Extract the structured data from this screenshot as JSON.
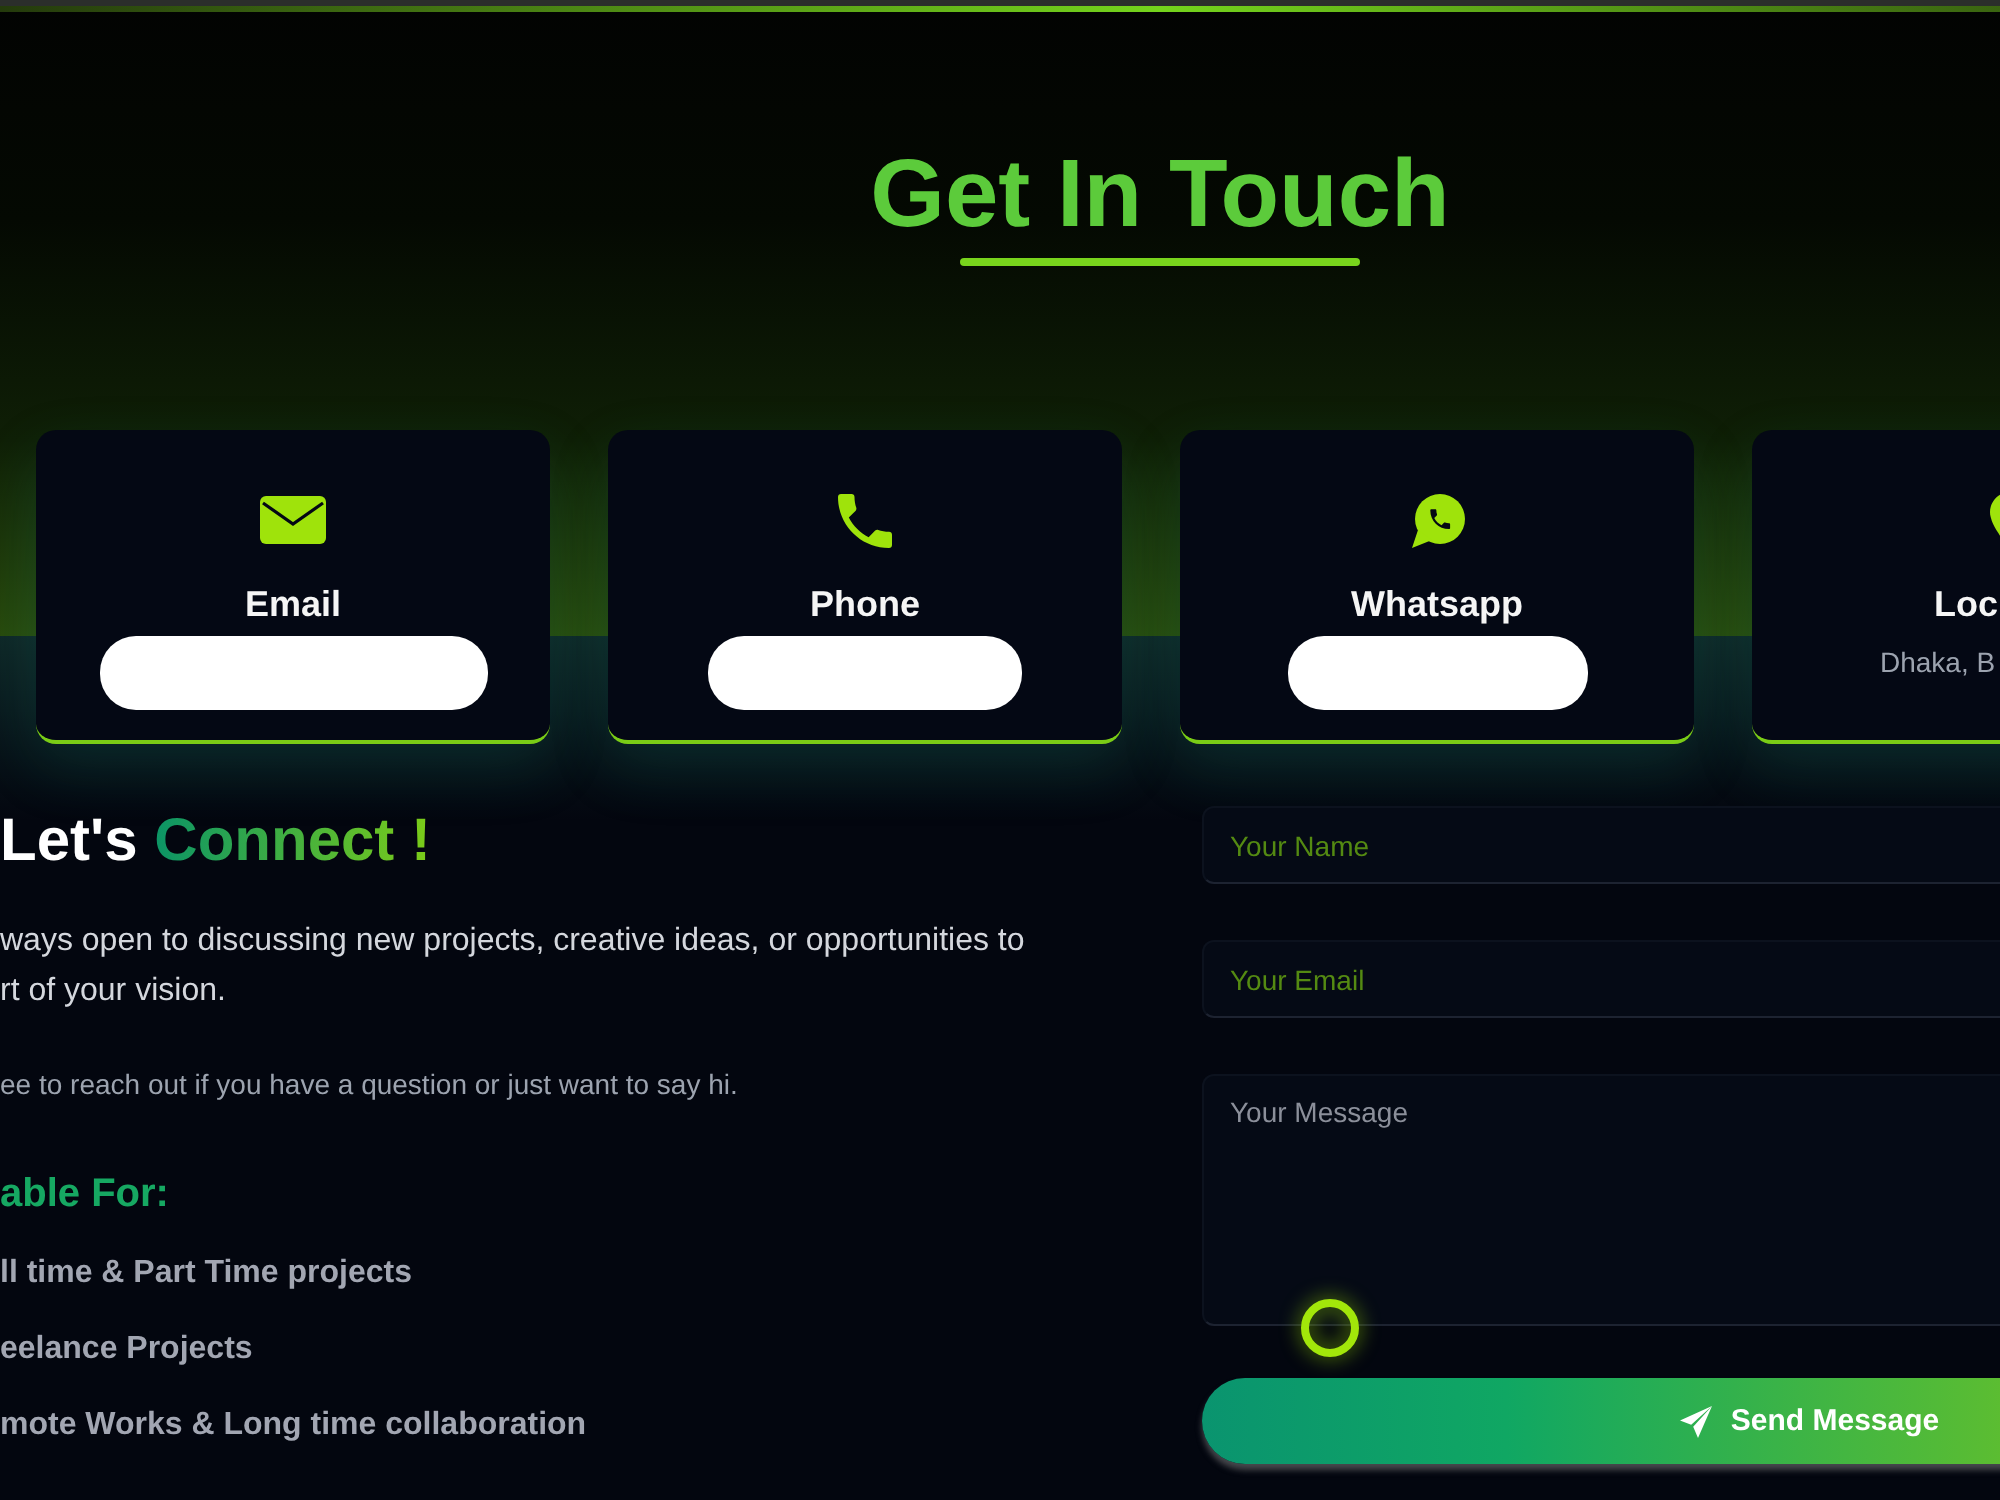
{
  "header": {
    "title": "Get In Touch"
  },
  "contact_cards": [
    {
      "kind": "email",
      "label": "Email",
      "value_redacted": true
    },
    {
      "kind": "phone",
      "label": "Phone",
      "value_redacted": true
    },
    {
      "kind": "whatsapp",
      "label": "Whatsapp",
      "value_redacted": true
    },
    {
      "kind": "location",
      "label": "Loc",
      "value": "Dhaka, B",
      "value_redacted": false
    }
  ],
  "intro": {
    "title": {
      "text": "Let's",
      "highlight": "Connect !"
    },
    "paragraph_lines": [
      "ways open to discussing new projects, creative ideas, or opportunities to",
      "rt of your vision."
    ],
    "note": "ee to reach out if you have a question or just want to say hi.",
    "availability": {
      "heading": "able For:",
      "items": [
        "ll time & Part Time projects",
        "eelance Projects",
        "mote Works & Long time collaboration"
      ]
    }
  },
  "form": {
    "fields": [
      {
        "kind": "input",
        "placeholder": "Your Name"
      },
      {
        "kind": "input",
        "placeholder": "Your Email"
      },
      {
        "kind": "textarea",
        "placeholder": "Your Message"
      }
    ],
    "submit": {
      "label": "Send Message"
    }
  }
}
